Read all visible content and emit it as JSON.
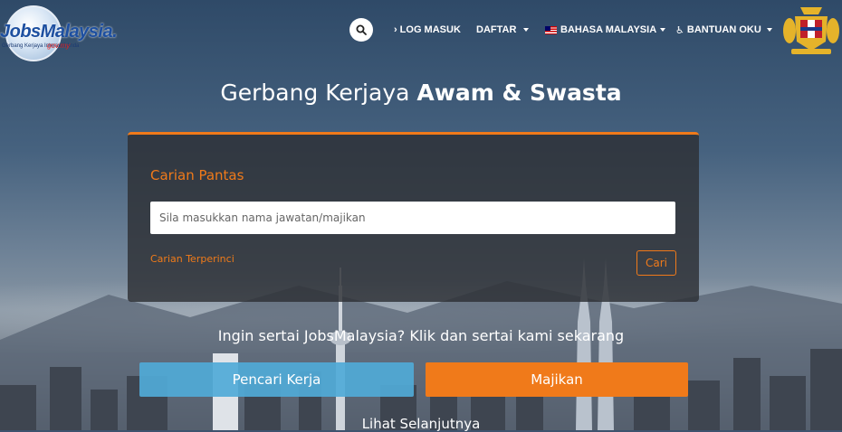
{
  "header": {
    "logo": {
      "text": "JobsMalaysia.",
      "tagline": "Gerbang Kerjaya Interaktif Anda",
      "tagline2": "gov.my"
    },
    "nav": {
      "login": "LOG MASUK",
      "register": "DAFTAR",
      "language": "BAHASA MALAYSIA",
      "accessibility": "BANTUAN OKU"
    }
  },
  "hero": {
    "title_normal": "Gerbang Kerjaya ",
    "title_bold": "Awam & Swasta"
  },
  "quick_search": {
    "title": "Carian Pantas",
    "placeholder": "Sila masukkan nama jawatan/majikan",
    "value": "",
    "advanced_link": "Carian Terperinci",
    "search_button": "Cari"
  },
  "join": {
    "text": "Ingin sertai JobsMalaysia? Klik dan sertai kami sekarang",
    "jobseeker_button": "Pencari Kerja",
    "employer_button": "Majikan",
    "more_link": "Lihat Selanjutnya"
  },
  "colors": {
    "accent": "#f07a1a",
    "jobseeker_blue": "#50aad7"
  }
}
